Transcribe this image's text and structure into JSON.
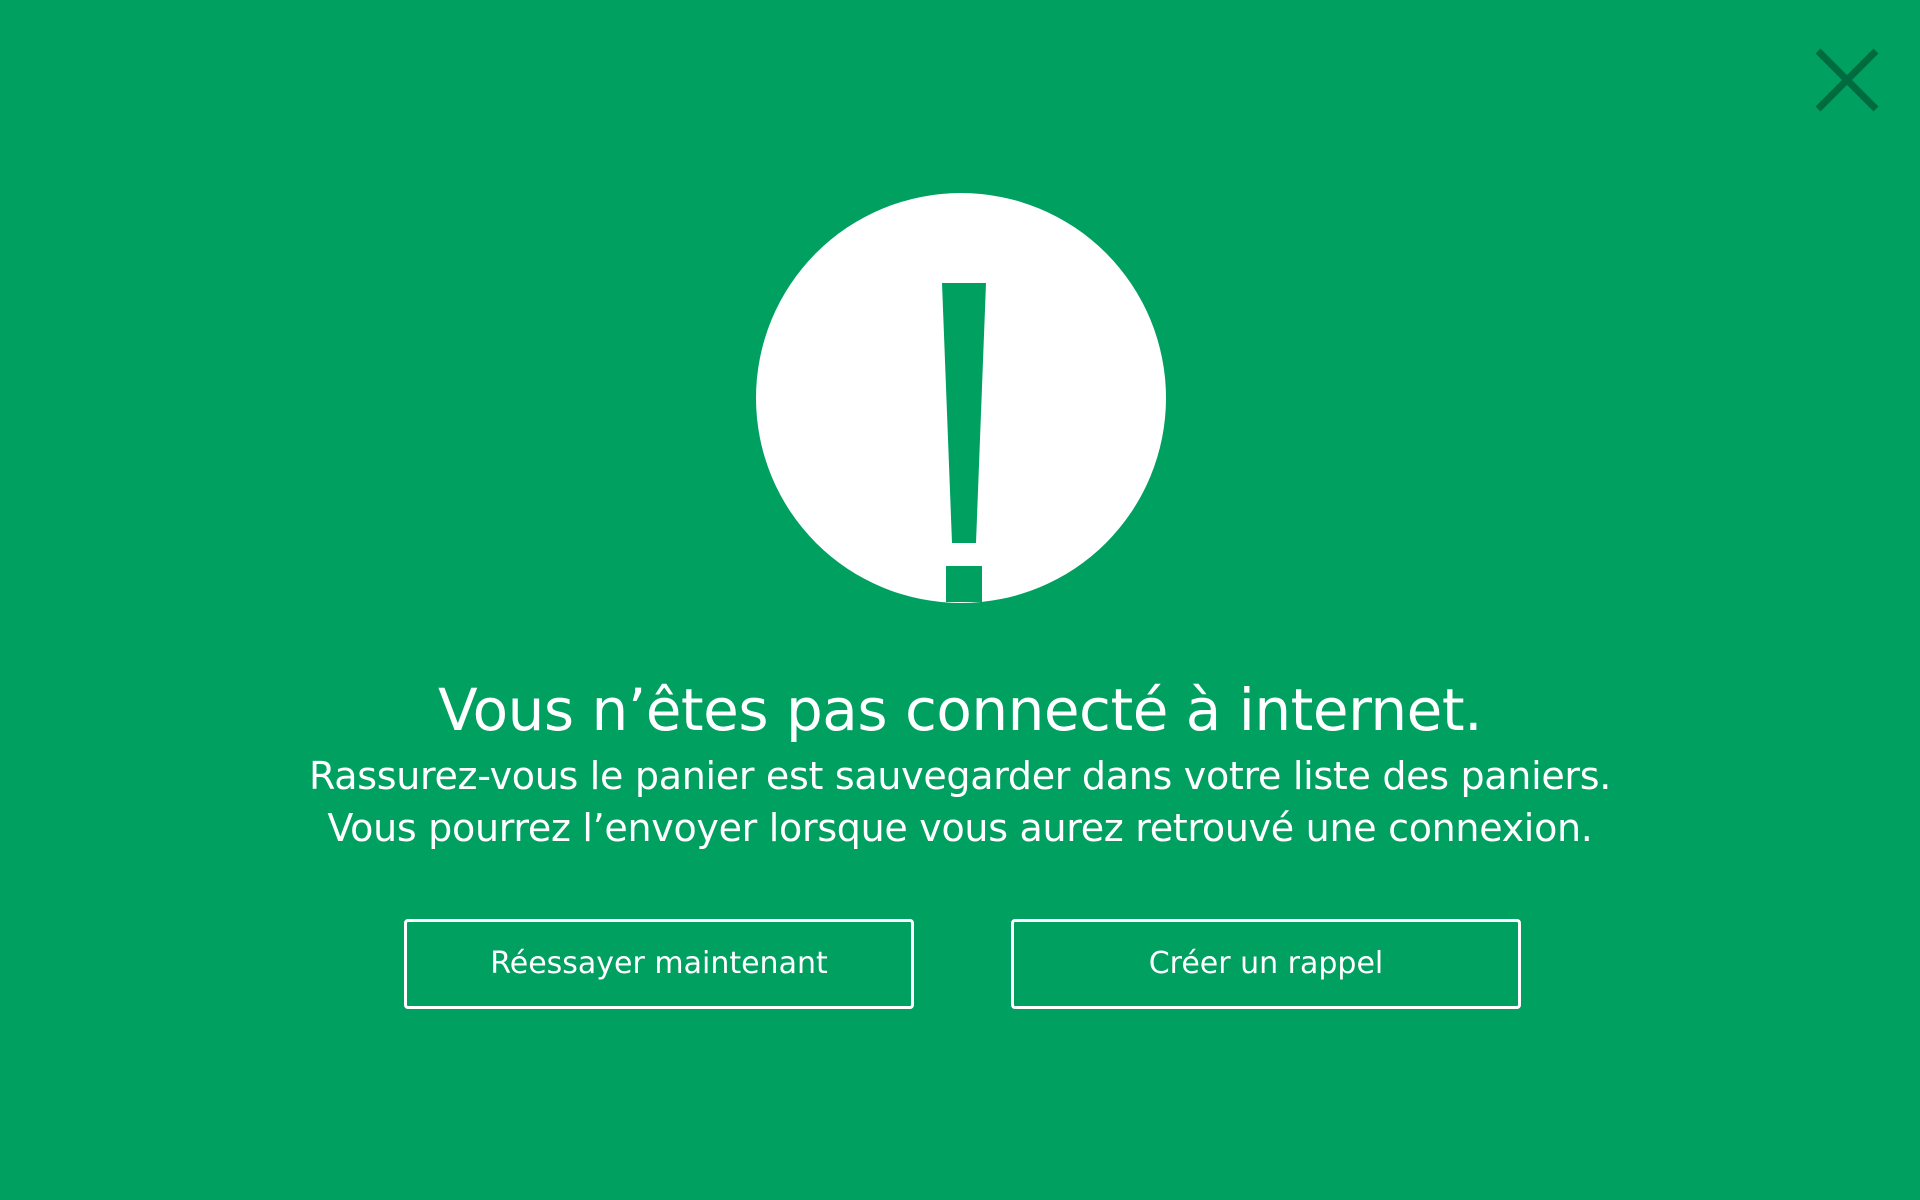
{
  "close": {
    "icon": "close-icon",
    "color": "#006b3f"
  },
  "alert": {
    "icon": "exclamation-icon",
    "circle_color": "#ffffff",
    "mark_color": "#00a061"
  },
  "title": "Vous n’êtes pas connecté à internet.",
  "message": {
    "line1": "Rassurez-vous le panier est sauvegarder dans votre liste des paniers.",
    "line2": "Vous pourrez l’envoyer lorsque vous aurez retrouvé une connexion."
  },
  "buttons": {
    "retry_label": "Réessayer maintenant",
    "reminder_label": "Créer un rappel"
  },
  "colors": {
    "background": "#00a061",
    "text": "#ffffff"
  }
}
